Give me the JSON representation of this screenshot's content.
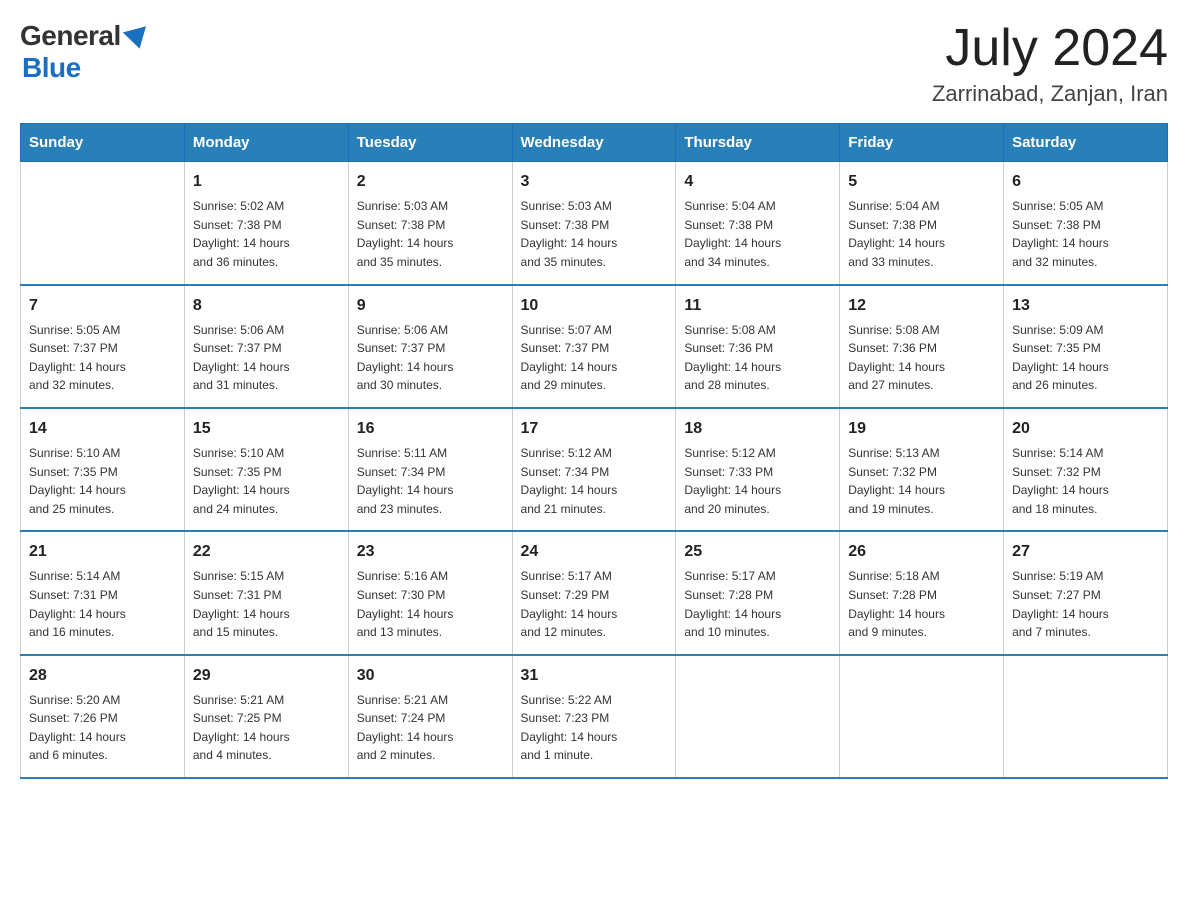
{
  "header": {
    "logo_general": "General",
    "logo_blue": "Blue",
    "month": "July 2024",
    "location": "Zarrinabad, Zanjan, Iran"
  },
  "days_of_week": [
    "Sunday",
    "Monday",
    "Tuesday",
    "Wednesday",
    "Thursday",
    "Friday",
    "Saturday"
  ],
  "weeks": [
    [
      {
        "day": "",
        "info": ""
      },
      {
        "day": "1",
        "info": "Sunrise: 5:02 AM\nSunset: 7:38 PM\nDaylight: 14 hours\nand 36 minutes."
      },
      {
        "day": "2",
        "info": "Sunrise: 5:03 AM\nSunset: 7:38 PM\nDaylight: 14 hours\nand 35 minutes."
      },
      {
        "day": "3",
        "info": "Sunrise: 5:03 AM\nSunset: 7:38 PM\nDaylight: 14 hours\nand 35 minutes."
      },
      {
        "day": "4",
        "info": "Sunrise: 5:04 AM\nSunset: 7:38 PM\nDaylight: 14 hours\nand 34 minutes."
      },
      {
        "day": "5",
        "info": "Sunrise: 5:04 AM\nSunset: 7:38 PM\nDaylight: 14 hours\nand 33 minutes."
      },
      {
        "day": "6",
        "info": "Sunrise: 5:05 AM\nSunset: 7:38 PM\nDaylight: 14 hours\nand 32 minutes."
      }
    ],
    [
      {
        "day": "7",
        "info": "Sunrise: 5:05 AM\nSunset: 7:37 PM\nDaylight: 14 hours\nand 32 minutes."
      },
      {
        "day": "8",
        "info": "Sunrise: 5:06 AM\nSunset: 7:37 PM\nDaylight: 14 hours\nand 31 minutes."
      },
      {
        "day": "9",
        "info": "Sunrise: 5:06 AM\nSunset: 7:37 PM\nDaylight: 14 hours\nand 30 minutes."
      },
      {
        "day": "10",
        "info": "Sunrise: 5:07 AM\nSunset: 7:37 PM\nDaylight: 14 hours\nand 29 minutes."
      },
      {
        "day": "11",
        "info": "Sunrise: 5:08 AM\nSunset: 7:36 PM\nDaylight: 14 hours\nand 28 minutes."
      },
      {
        "day": "12",
        "info": "Sunrise: 5:08 AM\nSunset: 7:36 PM\nDaylight: 14 hours\nand 27 minutes."
      },
      {
        "day": "13",
        "info": "Sunrise: 5:09 AM\nSunset: 7:35 PM\nDaylight: 14 hours\nand 26 minutes."
      }
    ],
    [
      {
        "day": "14",
        "info": "Sunrise: 5:10 AM\nSunset: 7:35 PM\nDaylight: 14 hours\nand 25 minutes."
      },
      {
        "day": "15",
        "info": "Sunrise: 5:10 AM\nSunset: 7:35 PM\nDaylight: 14 hours\nand 24 minutes."
      },
      {
        "day": "16",
        "info": "Sunrise: 5:11 AM\nSunset: 7:34 PM\nDaylight: 14 hours\nand 23 minutes."
      },
      {
        "day": "17",
        "info": "Sunrise: 5:12 AM\nSunset: 7:34 PM\nDaylight: 14 hours\nand 21 minutes."
      },
      {
        "day": "18",
        "info": "Sunrise: 5:12 AM\nSunset: 7:33 PM\nDaylight: 14 hours\nand 20 minutes."
      },
      {
        "day": "19",
        "info": "Sunrise: 5:13 AM\nSunset: 7:32 PM\nDaylight: 14 hours\nand 19 minutes."
      },
      {
        "day": "20",
        "info": "Sunrise: 5:14 AM\nSunset: 7:32 PM\nDaylight: 14 hours\nand 18 minutes."
      }
    ],
    [
      {
        "day": "21",
        "info": "Sunrise: 5:14 AM\nSunset: 7:31 PM\nDaylight: 14 hours\nand 16 minutes."
      },
      {
        "day": "22",
        "info": "Sunrise: 5:15 AM\nSunset: 7:31 PM\nDaylight: 14 hours\nand 15 minutes."
      },
      {
        "day": "23",
        "info": "Sunrise: 5:16 AM\nSunset: 7:30 PM\nDaylight: 14 hours\nand 13 minutes."
      },
      {
        "day": "24",
        "info": "Sunrise: 5:17 AM\nSunset: 7:29 PM\nDaylight: 14 hours\nand 12 minutes."
      },
      {
        "day": "25",
        "info": "Sunrise: 5:17 AM\nSunset: 7:28 PM\nDaylight: 14 hours\nand 10 minutes."
      },
      {
        "day": "26",
        "info": "Sunrise: 5:18 AM\nSunset: 7:28 PM\nDaylight: 14 hours\nand 9 minutes."
      },
      {
        "day": "27",
        "info": "Sunrise: 5:19 AM\nSunset: 7:27 PM\nDaylight: 14 hours\nand 7 minutes."
      }
    ],
    [
      {
        "day": "28",
        "info": "Sunrise: 5:20 AM\nSunset: 7:26 PM\nDaylight: 14 hours\nand 6 minutes."
      },
      {
        "day": "29",
        "info": "Sunrise: 5:21 AM\nSunset: 7:25 PM\nDaylight: 14 hours\nand 4 minutes."
      },
      {
        "day": "30",
        "info": "Sunrise: 5:21 AM\nSunset: 7:24 PM\nDaylight: 14 hours\nand 2 minutes."
      },
      {
        "day": "31",
        "info": "Sunrise: 5:22 AM\nSunset: 7:23 PM\nDaylight: 14 hours\nand 1 minute."
      },
      {
        "day": "",
        "info": ""
      },
      {
        "day": "",
        "info": ""
      },
      {
        "day": "",
        "info": ""
      }
    ]
  ]
}
